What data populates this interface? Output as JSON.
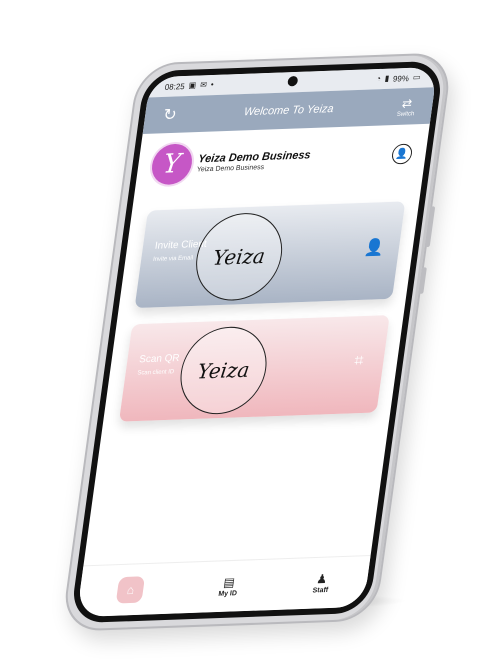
{
  "status": {
    "time": "08:25",
    "battery": "99%"
  },
  "header": {
    "title": "Welcome To Yeiza",
    "switch_label": "Switch"
  },
  "business": {
    "logo_letter": "Y",
    "name": "Yeiza Demo Business",
    "sub": "Yeiza Demo Business"
  },
  "cards": [
    {
      "title": "Invite Client",
      "sub": "Invite via Email",
      "emblem": "Yeiza"
    },
    {
      "title": "Scan QR",
      "sub": "Scan client ID",
      "emblem": "Yeiza"
    }
  ],
  "nav": {
    "myid_label": "My ID",
    "staff_label": "Staff"
  },
  "colors": {
    "header": "#9aa9bd",
    "accent_pink": "#f1c3c8",
    "logo": "#c657c6"
  }
}
